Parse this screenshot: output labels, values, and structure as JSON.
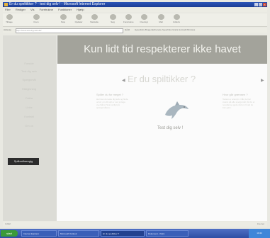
{
  "window": {
    "title": "Er du speltikker ? - test dig selv ! - Microsoft Internet Explorer",
    "controls": [
      "_",
      "□",
      "×"
    ]
  },
  "menu": [
    "Filer",
    "Rediger",
    "Vis",
    "Foretrukne",
    "Funktioner",
    "Hjælp"
  ],
  "toolbar": [
    {
      "label": "Tilbage",
      "icon": "back-icon"
    },
    {
      "label": "Frem",
      "icon": "forward-icon"
    },
    {
      "label": "Stop",
      "icon": "stop-icon"
    },
    {
      "label": "Opdater",
      "icon": "refresh-icon"
    },
    {
      "label": "Startside",
      "icon": "home-icon"
    },
    {
      "label": "Søg",
      "icon": "search-icon"
    },
    {
      "label": "Foretrukne",
      "icon": "favorites-icon"
    },
    {
      "label": "Oversigt",
      "icon": "history-icon"
    },
    {
      "label": "Mail",
      "icon": "mail-icon"
    },
    {
      "label": "Udskriv",
      "icon": "print-icon"
    }
  ],
  "address": {
    "label": "Adresse",
    "url": "http://www.test-dig-selv.dk/",
    "go": "Gå til",
    "links": "Hyperlinks  Brugerdefinerede hyperlinks  Gratis Hotmail  Windows"
  },
  "page": {
    "nav": [
      "Forside",
      "Test dig selv",
      "Spørgsmål",
      "Rådgivning",
      "Fakta",
      "Links",
      "Kontakt",
      "Om os"
    ],
    "nav_button": "Spilleafhængig",
    "banner": "Kun lidt tid respekterer ikke havet",
    "question": "Er du spiltikker ?",
    "left_col_heading": "Spiller du for meget ?",
    "left_col_text": "Her kan du teste dig selv og finde ud af, om dit spil er ved at tage overhånd. Svar ærligt på spørgsmålene.",
    "right_col_heading": "Hvor går grænsen ?",
    "right_col_text": "Testen er anonym. Når du har svaret på alle spørgsmål, får du et resultat og gode råd om hvad du kan gøre.",
    "cta": "Test dig selv !"
  },
  "status": {
    "text": "Udført",
    "zone": "Internet"
  },
  "taskbar": {
    "start": "start",
    "tasks": [
      "Internet Explorer",
      "Microsoft Outlook",
      "Er du speltikker ?",
      "Dokument - Paint"
    ],
    "clock": "10:42"
  }
}
